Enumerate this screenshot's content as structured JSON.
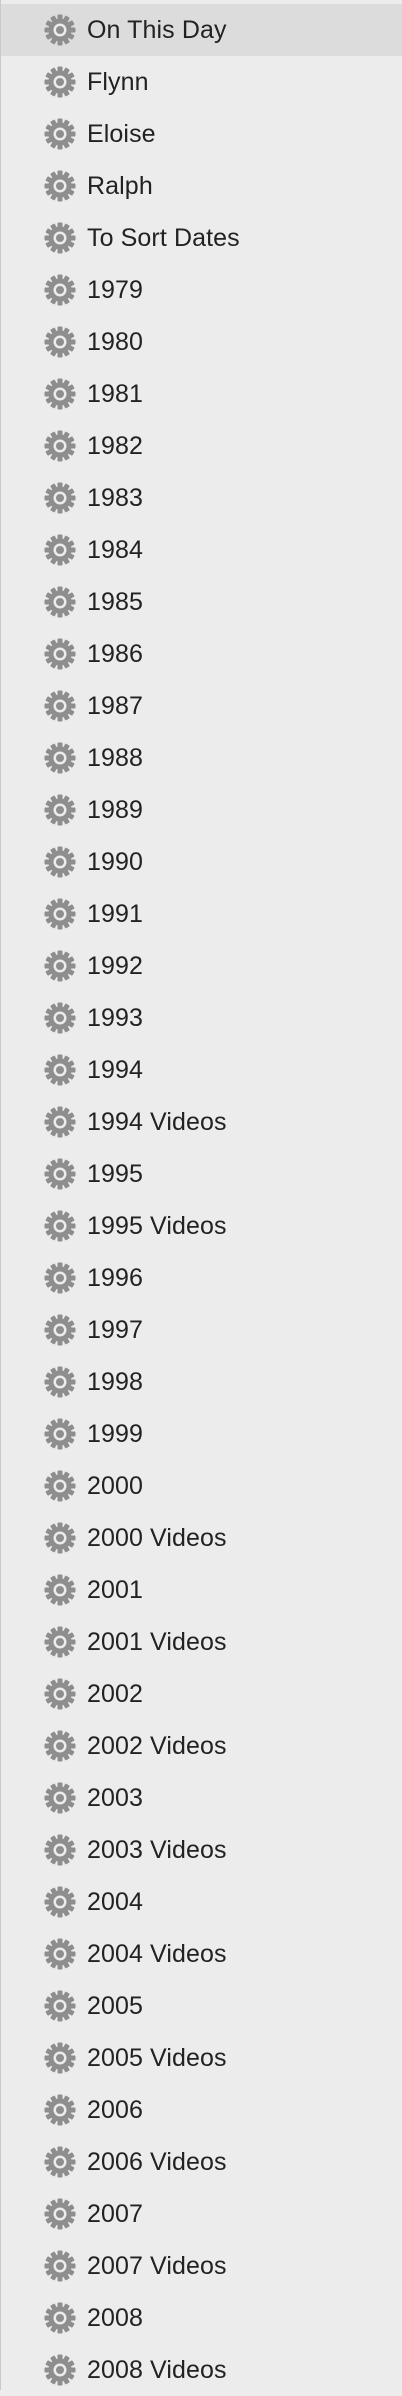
{
  "sidebar": {
    "items": [
      {
        "label": "On This Day",
        "icon": "gear-icon",
        "selected": true
      },
      {
        "label": "Flynn",
        "icon": "gear-icon"
      },
      {
        "label": "Eloise",
        "icon": "gear-icon"
      },
      {
        "label": "Ralph",
        "icon": "gear-icon"
      },
      {
        "label": "To Sort Dates",
        "icon": "gear-icon"
      },
      {
        "label": "1979",
        "icon": "gear-icon"
      },
      {
        "label": "1980",
        "icon": "gear-icon"
      },
      {
        "label": "1981",
        "icon": "gear-icon"
      },
      {
        "label": "1982",
        "icon": "gear-icon"
      },
      {
        "label": "1983",
        "icon": "gear-icon"
      },
      {
        "label": "1984",
        "icon": "gear-icon"
      },
      {
        "label": "1985",
        "icon": "gear-icon"
      },
      {
        "label": "1986",
        "icon": "gear-icon"
      },
      {
        "label": "1987",
        "icon": "gear-icon"
      },
      {
        "label": "1988",
        "icon": "gear-icon"
      },
      {
        "label": "1989",
        "icon": "gear-icon"
      },
      {
        "label": "1990",
        "icon": "gear-icon"
      },
      {
        "label": "1991",
        "icon": "gear-icon"
      },
      {
        "label": "1992",
        "icon": "gear-icon"
      },
      {
        "label": "1993",
        "icon": "gear-icon"
      },
      {
        "label": "1994",
        "icon": "gear-icon"
      },
      {
        "label": "1994 Videos",
        "icon": "gear-icon"
      },
      {
        "label": "1995",
        "icon": "gear-icon"
      },
      {
        "label": "1995 Videos",
        "icon": "gear-icon"
      },
      {
        "label": "1996",
        "icon": "gear-icon"
      },
      {
        "label": "1997",
        "icon": "gear-icon"
      },
      {
        "label": "1998",
        "icon": "gear-icon"
      },
      {
        "label": "1999",
        "icon": "gear-icon"
      },
      {
        "label": "2000",
        "icon": "gear-icon"
      },
      {
        "label": "2000 Videos",
        "icon": "gear-icon"
      },
      {
        "label": "2001",
        "icon": "gear-icon"
      },
      {
        "label": "2001 Videos",
        "icon": "gear-icon"
      },
      {
        "label": "2002",
        "icon": "gear-icon"
      },
      {
        "label": "2002 Videos",
        "icon": "gear-icon"
      },
      {
        "label": "2003",
        "icon": "gear-icon"
      },
      {
        "label": "2003 Videos",
        "icon": "gear-icon"
      },
      {
        "label": "2004",
        "icon": "gear-icon"
      },
      {
        "label": "2004 Videos",
        "icon": "gear-icon"
      },
      {
        "label": "2005",
        "icon": "gear-icon"
      },
      {
        "label": "2005 Videos",
        "icon": "gear-icon"
      },
      {
        "label": "2006",
        "icon": "gear-icon"
      },
      {
        "label": "2006 Videos",
        "icon": "gear-icon"
      },
      {
        "label": "2007",
        "icon": "gear-icon"
      },
      {
        "label": "2007 Videos",
        "icon": "gear-icon"
      },
      {
        "label": "2008",
        "icon": "gear-icon"
      },
      {
        "label": "2008 Videos",
        "icon": "gear-icon"
      }
    ]
  },
  "colors": {
    "background": "#ececec",
    "selected_row": "#dcdcdc",
    "icon": "#8e8e8e",
    "text": "#222222"
  }
}
